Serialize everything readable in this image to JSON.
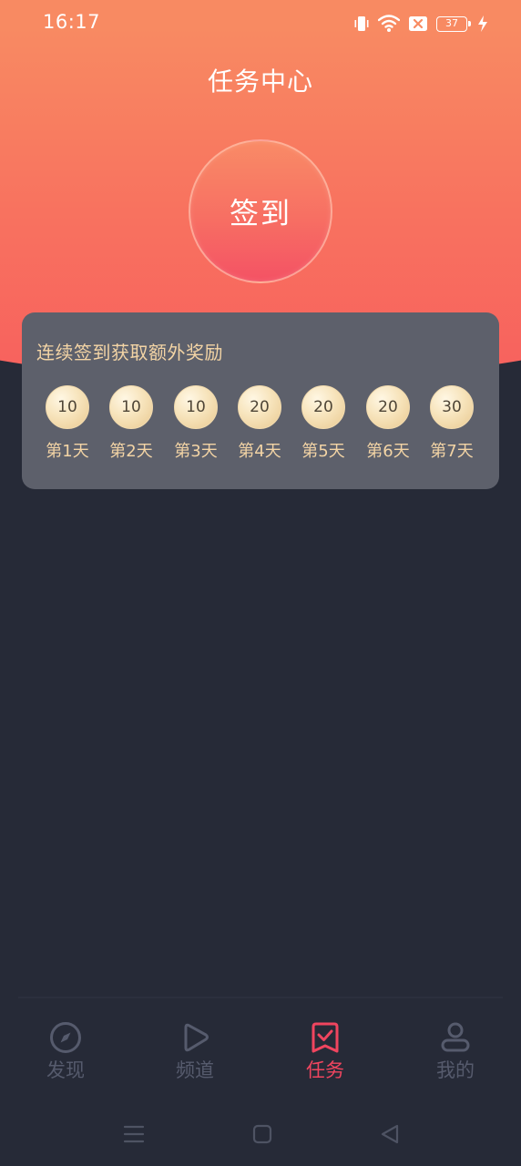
{
  "status_bar": {
    "time": "16:17",
    "battery": "37"
  },
  "header": {
    "title": "任务中心"
  },
  "signin": {
    "label": "签到"
  },
  "reward_card": {
    "title": "连续签到获取额外奖励",
    "days": [
      {
        "coins": "10",
        "label": "第1天"
      },
      {
        "coins": "10",
        "label": "第2天"
      },
      {
        "coins": "10",
        "label": "第3天"
      },
      {
        "coins": "20",
        "label": "第4天"
      },
      {
        "coins": "20",
        "label": "第5天"
      },
      {
        "coins": "20",
        "label": "第6天"
      },
      {
        "coins": "30",
        "label": "第7天"
      }
    ]
  },
  "tabs": [
    {
      "label": "发现",
      "icon": "compass-icon",
      "active": false
    },
    {
      "label": "频道",
      "icon": "play-icon",
      "active": false
    },
    {
      "label": "任务",
      "icon": "task-check-icon",
      "active": true
    },
    {
      "label": "我的",
      "icon": "user-icon",
      "active": false
    }
  ],
  "colors": {
    "accent": "#f0455f",
    "tab_inactive": "#565b6d",
    "gold_text": "#f3d4a5",
    "background": "#262a37",
    "header_gradient_top": "#f88b62",
    "header_gradient_bottom": "#f7615e"
  }
}
